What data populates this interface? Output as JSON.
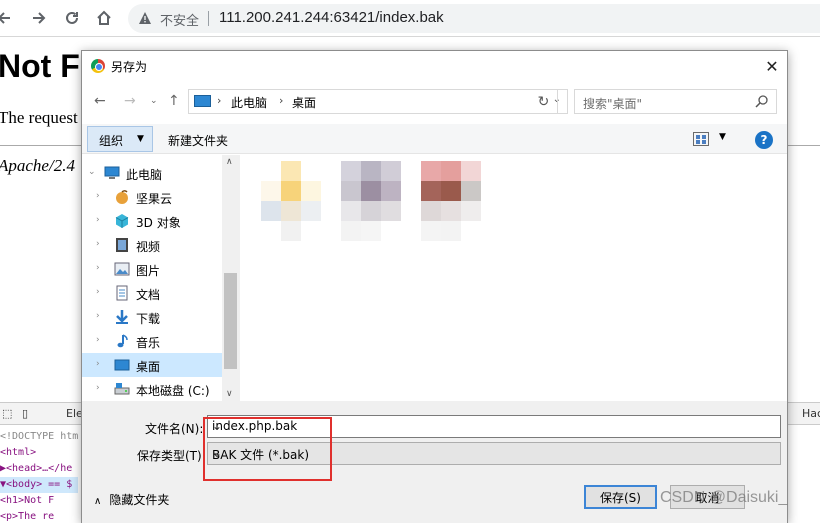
{
  "browser": {
    "insecure_label": "不安全",
    "url": "111.200.241.244:63421/index.bak"
  },
  "page": {
    "heading": "Not F",
    "line": "The request",
    "footer": "Apache/2.4"
  },
  "devtools": {
    "tab_elements": "Ele",
    "tab_right": "Hac",
    "code_lines": [
      "<!DOCTYPE htm",
      "<html>",
      "▶<head>…</he",
      "▼<body> == $",
      "   <h1>Not F",
      "   <p>The re"
    ]
  },
  "dialog": {
    "title": "另存为",
    "breadcrumb": [
      "此电脑",
      "桌面"
    ],
    "search_placeholder": "搜索\"桌面\"",
    "organize_label": "组织",
    "new_folder_label": "新建文件夹",
    "help_label": "?",
    "nav_items": [
      {
        "label": "此电脑",
        "icon": "computer-icon",
        "root": true
      },
      {
        "label": "坚果云",
        "icon": "nutstore-icon"
      },
      {
        "label": "3D 对象",
        "icon": "3d-objects-icon"
      },
      {
        "label": "视频",
        "icon": "video-icon"
      },
      {
        "label": "图片",
        "icon": "pictures-icon"
      },
      {
        "label": "文档",
        "icon": "documents-icon"
      },
      {
        "label": "下载",
        "icon": "download-icon"
      },
      {
        "label": "音乐",
        "icon": "music-icon"
      },
      {
        "label": "桌面",
        "icon": "desktop-icon",
        "selected": true
      },
      {
        "label": "本地磁盘 (C:)",
        "icon": "drive-icon"
      }
    ],
    "filename_label": "文件名(N):",
    "filename_value": "index.php.bak",
    "filetype_label": "保存类型(T):",
    "filetype_value": "BAK 文件 (*.bak)",
    "hide_folders_label": "隐藏文件夹",
    "save_label": "保存(S)",
    "cancel_label": "取消"
  },
  "colors": {
    "accent": "#3c85d6",
    "selection": "#cce8ff",
    "annotation_red": "#e0302d"
  },
  "watermark": "CSDN @Daisuki_"
}
